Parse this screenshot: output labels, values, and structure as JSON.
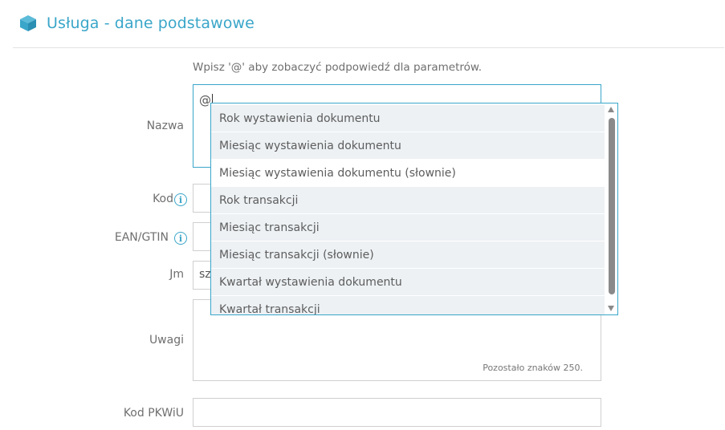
{
  "header": {
    "title": "Usługa - dane podstawowe",
    "icon": "cube-icon",
    "accent": "#3aa6c9"
  },
  "hint": "Wpisz '@' aby zobaczyć podpowiedź dla parametrów.",
  "form": {
    "nazwa": {
      "label": "Nazwa",
      "value": "@"
    },
    "kod": {
      "label": "Kod",
      "value": ""
    },
    "ean": {
      "label": "EAN/GTIN",
      "value": ""
    },
    "jm": {
      "label": "Jm",
      "value": "sz"
    },
    "uwagi": {
      "label": "Uwagi",
      "value": "",
      "counter": "Pozostało znaków 250."
    },
    "pkwiu": {
      "label": "Kod PKWiU",
      "value": ""
    }
  },
  "info_icon_glyph": "i",
  "dropdown": {
    "items": [
      "Rok wystawienia dokumentu",
      "Miesiąc wystawienia dokumentu",
      "Miesiąc wystawienia dokumentu (słownie)",
      "Rok transakcji",
      "Miesiąc transakcji",
      "Miesiąc transakcji (słownie)",
      "Kwartał wystawienia dokumentu",
      "Kwartał transakcji"
    ],
    "hover_index": 2
  }
}
